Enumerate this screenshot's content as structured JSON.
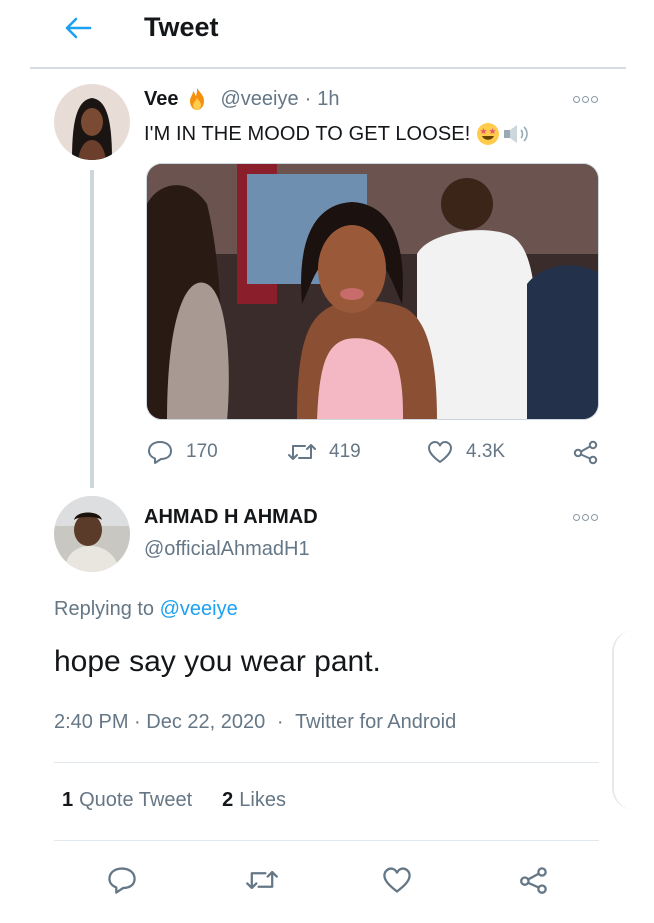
{
  "header": {
    "title": "Tweet"
  },
  "original_tweet": {
    "name": "Vee",
    "name_emoji": "fire",
    "handle": "@veeiye",
    "separator": "·",
    "time": "1h",
    "text": "I'M IN THE MOOD TO GET LOOSE!",
    "text_emojis": [
      "star-struck",
      "speaker"
    ],
    "actions": {
      "replies": "170",
      "retweets": "419",
      "likes": "4.3K"
    }
  },
  "reply_tweet": {
    "name": "AHMAD H AHMAD",
    "handle": "@officialAhmadH1",
    "replying_prefix": "Replying to",
    "replying_to": "@veeiye",
    "text": "hope say you wear pant.",
    "time": "2:40 PM",
    "sep1": "·",
    "date": "Dec 22, 2020",
    "sep2": "·",
    "source": "Twitter for Android",
    "stats": {
      "quote_count": "1",
      "quote_label": "Quote Tweet",
      "like_count": "2",
      "like_label": "Likes"
    }
  },
  "colors": {
    "accent": "#1da1f2",
    "text": "#14171a",
    "muted": "#657786",
    "divider": "#e1e8ed"
  }
}
